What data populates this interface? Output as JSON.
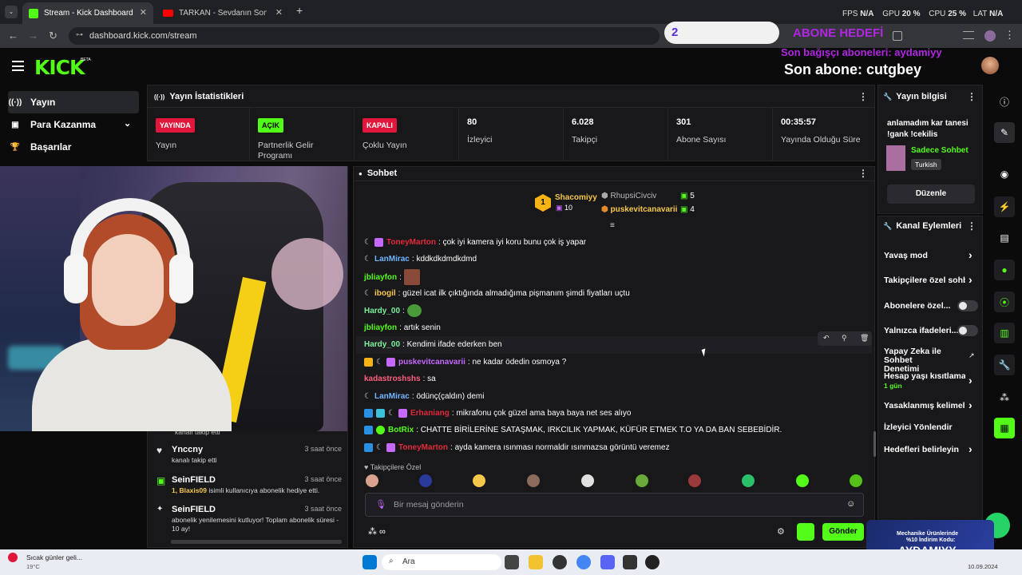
{
  "browser": {
    "tabs": [
      {
        "title": "Stream - Kick Dashboard",
        "active": true
      },
      {
        "title": "TARKAN - Sevdanın Son Vuruş",
        "active": false
      }
    ],
    "new_tab": "+",
    "url": "dashboard.kick.com/stream"
  },
  "overlay": {
    "fps_label": "FPS",
    "fps_value": "N/A",
    "gpu_label": "GPU",
    "gpu_value": "20 %",
    "cpu_label": "CPU",
    "cpu_value": "25 %",
    "lat_label": "LAT",
    "lat_value": "N/A",
    "goal_count": "2",
    "sub_goal": "ABONE HEDEFİ",
    "last_donor": "Son bağışçı aboneleri: aydamiyy",
    "last_sub": "Son abone: cutgbey"
  },
  "kick": {
    "logo": "KICK",
    "beta": "BETA"
  },
  "leftnav": [
    {
      "label": "Yayın",
      "icon": "((·))"
    },
    {
      "label": "Para Kazanma",
      "icon": "▣"
    },
    {
      "label": "Başarılar",
      "icon": "🏆"
    }
  ],
  "stats": {
    "title": "Yayın İstatistikleri",
    "cells": [
      {
        "badge": "YAYINDA",
        "label": "Yayın"
      },
      {
        "badge": "AÇIK",
        "label": "Partnerlik Gelir Programı"
      },
      {
        "badge": "KAPALI",
        "label": "Çoklu Yayın"
      },
      {
        "value": "80",
        "label": "İzleyici"
      },
      {
        "value": "6.028",
        "label": "Takipçi"
      },
      {
        "value": "301",
        "label": "Abone Sayısı"
      },
      {
        "value": "00:35:57",
        "label": "Yayında Olduğu Süre"
      }
    ]
  },
  "activity": [
    {
      "name": "kanalı takip etti",
      "desc": ""
    },
    {
      "name": "Ynccny",
      "time": "3 saat önce",
      "desc": "kanalı takip etti"
    },
    {
      "name": "SeinFIELD",
      "time": "3 saat önce",
      "desc_pre": "1, Blaxis09",
      "desc": "isimli kullanıcıya abonelik hediye etti."
    },
    {
      "name": "SeinFIELD",
      "time": "3 saat önce",
      "desc": "abonelik yenilemesini kutluyor! Toplam abonelik süresi - 10 ay!"
    }
  ],
  "chat": {
    "title": "Sohbet",
    "leaders": [
      {
        "rank": "1",
        "name": "Shacomiyy",
        "count": "10"
      },
      {
        "name": "RhupsiCivciv",
        "count": "5"
      },
      {
        "name": "puskevitcanavarii",
        "count": "4"
      }
    ],
    "messages": [
      {
        "user": "ToneyMarton",
        "color": "#e02a3a",
        "text": "çok iyi kamera iyi koru bunu çok iş yapar"
      },
      {
        "user": "LanMirac",
        "color": "#6fb6ff",
        "text": "kddkdkdmdkdmd"
      },
      {
        "user": "jbliayfon",
        "color": "#53fc18",
        "text": ""
      },
      {
        "user": "ibogil",
        "color": "#f5c84c",
        "text": "güzel icat ilk çıktığında almadığıma pişmanım şimdi fiyatları uçtu"
      },
      {
        "user": "Hardy_00",
        "color": "#7cf29a",
        "text": ""
      },
      {
        "user": "jbliayfon",
        "color": "#53fc18",
        "text": "artık senin"
      },
      {
        "user": "Hardy_00",
        "color": "#7cf29a",
        "text": "Kendimi ifade ederken ben"
      },
      {
        "user": "puskevitcanavarii",
        "color": "#c569ff",
        "text": "ne kadar ödedin osmoya ?"
      },
      {
        "user": "kadastroshshs",
        "color": "#ff5e7e",
        "text": "sa"
      },
      {
        "user": "LanMirac",
        "color": "#6fb6ff",
        "text": "ödünç(çaldın) demi"
      },
      {
        "user": "Erhaniang",
        "color": "#e02a3a",
        "text": "mikrafonu çok güzel ama baya baya net ses alıyo"
      },
      {
        "user": "BotRix",
        "color": "#53fc18",
        "text": "CHATTE BİRİLERİNE SATAŞMAK, IRKCILIK YAPMAK, KÜFÜR ETMEK T.O YA DA BAN SEBEBİDİR."
      },
      {
        "user": "ToneyMarton",
        "color": "#e02a3a",
        "text": "ayda kamera ısınması normaldir ısınmazsa görüntü veremez"
      }
    ],
    "emote_section": "Takipçilere Özel",
    "input_placeholder": "Bir mesaj gönderin",
    "send": "Gönder"
  },
  "stream_info": {
    "title": "Yayın bilgisi",
    "stream_title": "anlamadım kar tanesi !gank !cekilis",
    "category": "Sadece Sohbet",
    "language": "Turkish",
    "edit": "Düzenle"
  },
  "channel_actions": {
    "title": "Kanal Eylemleri",
    "items": [
      "Yavaş mod",
      "Takipçilere özel sohb",
      "Abonelere özel...",
      "Yalnızca ifadeleri...",
      "Yapay Zeka ile Sohbet Denetimi",
      "Hesap yaşı kısıtlaması",
      "Yasaklanmış kelimele",
      "İzleyici Yönlendir",
      "Hedefleri belirleyin"
    ],
    "account_age_value": "1 gün"
  },
  "promo": {
    "line1": "Mechanike Ürünlerinde",
    "line2": "%10 İndirim Kodu:",
    "code": "AYDAMIYY"
  },
  "taskbar": {
    "weather": "Sıcak günler geli...",
    "temp": "19°C",
    "search": "Ara",
    "date": "10.09.2024"
  }
}
